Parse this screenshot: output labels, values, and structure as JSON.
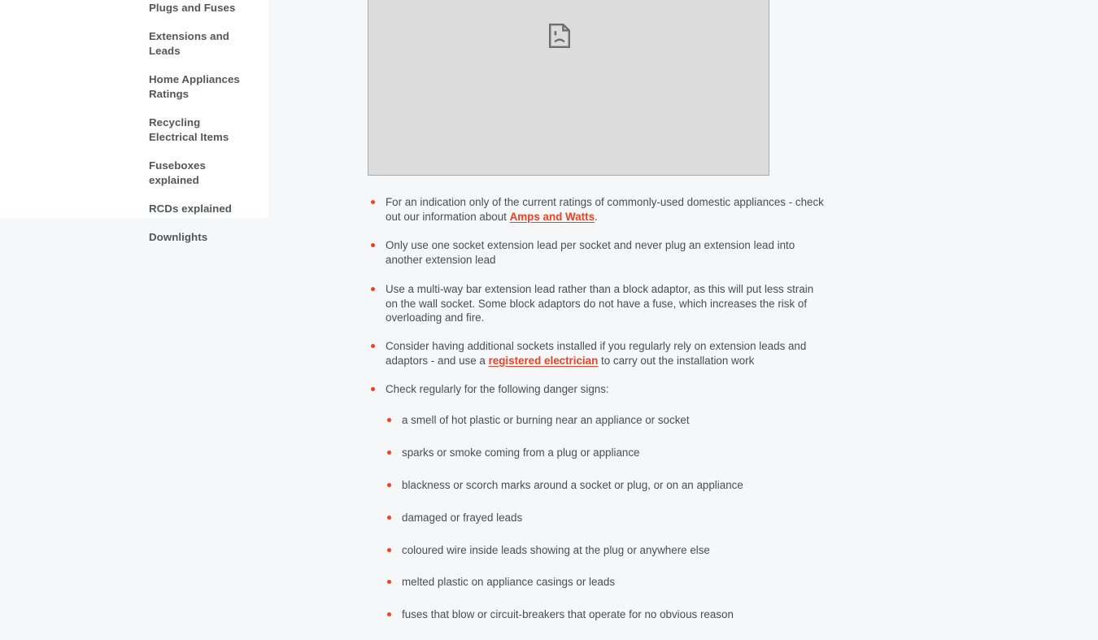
{
  "sidebar": {
    "items": [
      {
        "label": "Plugs and Fuses"
      },
      {
        "label": "Extensions and Leads"
      },
      {
        "label": "Home Appliances Ratings"
      },
      {
        "label": "Recycling Electrical Items"
      },
      {
        "label": "Fuseboxes explained"
      },
      {
        "label": "RCDs explained"
      },
      {
        "label": "Downlights"
      }
    ]
  },
  "main": {
    "image": {
      "alt": "",
      "icon": "broken-image-icon"
    },
    "bullets": [
      {
        "before": "For an indication only of the current ratings of commonly-used domestic appliances - check out our information about ",
        "link": "Amps and Watts",
        "after": "."
      },
      {
        "before": "Only use one socket extension lead per socket and never plug an extension lead into another extension lead",
        "link": "",
        "after": ""
      },
      {
        "before": "Use a multi-way bar extension lead rather than a block adaptor, as this will put less strain on the wall socket. Some block adaptors do not have a fuse, which increases the risk of overloading and fire.",
        "link": "",
        "after": ""
      },
      {
        "before": "Consider having additional sockets installed if you regularly rely on extension leads and adaptors - and use a ",
        "link": "registered electrician",
        "after": " to carry out the installation work"
      },
      {
        "before": "Check regularly for the following danger signs:",
        "link": "",
        "after": ""
      }
    ],
    "danger_signs": [
      "a smell of hot plastic or burning near an appliance or socket",
      "sparks or smoke coming from a plug or appliance",
      "blackness or scorch marks around a socket or plug, or on an appliance",
      "damaged or frayed leads",
      "coloured wire inside leads showing at the plug or anywhere else",
      "melted plastic on appliance casings or leads",
      "fuses that blow or circuit-breakers that operate for no obvious reason"
    ]
  },
  "colors": {
    "accent": "#ef4023",
    "page_background": "#f6f7f9",
    "card_background": "#ffffff",
    "text": "#4c4c52",
    "nav_text": "#55565c",
    "placeholder_fill": "#dcdcdc",
    "placeholder_border": "#a9abae"
  }
}
